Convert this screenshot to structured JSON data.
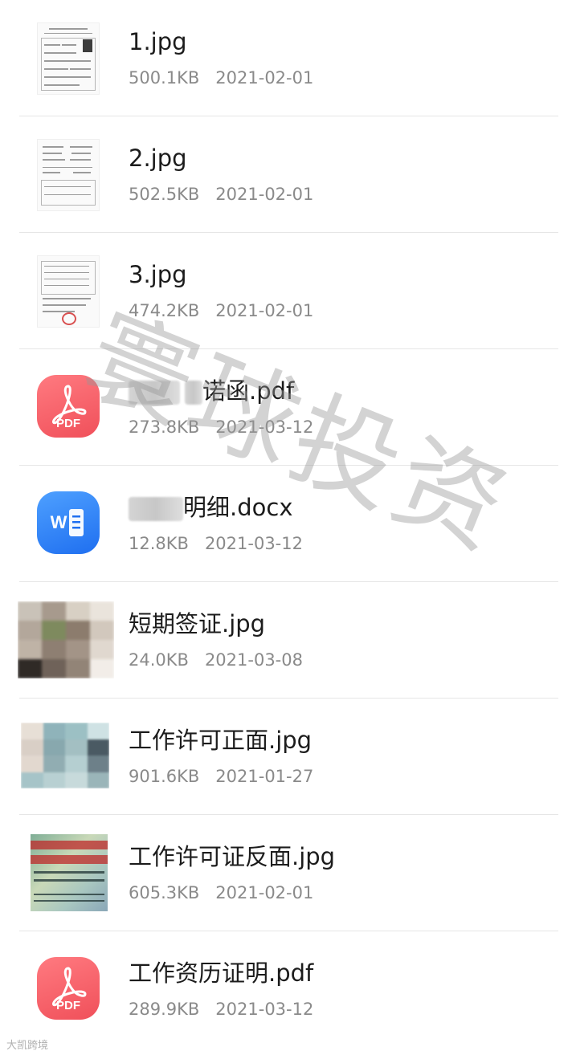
{
  "files": [
    {
      "name": "1.jpg",
      "size": "500.1KB",
      "date": "2021-02-01",
      "thumbnail": "document-scan-with-photo-icon"
    },
    {
      "name": "2.jpg",
      "size": "502.5KB",
      "date": "2021-02-01",
      "thumbnail": "document-scan-icon"
    },
    {
      "name": "3.jpg",
      "size": "474.2KB",
      "date": "2021-02-01",
      "thumbnail": "document-scan-with-stamp-icon"
    },
    {
      "name_visible": "诺函.pdf",
      "size": "273.8KB",
      "date": "2021-03-12",
      "thumbnail": "pdf-file-icon",
      "icon_label": "PDF"
    },
    {
      "name_visible": "明细.docx",
      "size": "12.8KB",
      "date": "2021-03-12",
      "thumbnail": "word-file-icon",
      "icon_label": "W"
    },
    {
      "name": "短期签证.jpg",
      "size_visible": "24.0KB",
      "date": "2021-03-08",
      "thumbnail": "blurred-photo-icon"
    },
    {
      "name": "工作许可正面.jpg",
      "size": "901.6KB",
      "date": "2021-01-27",
      "thumbnail": "blurred-permit-front-icon"
    },
    {
      "name": "工作许可证反面.jpg",
      "size": "605.3KB",
      "date": "2021-02-01",
      "thumbnail": "permit-back-icon"
    },
    {
      "name": "工作资历证明.pdf",
      "size": "289.9KB",
      "date": "2021-03-12",
      "thumbnail": "pdf-file-icon",
      "icon_label": "PDF"
    }
  ],
  "watermark": "寰球投资",
  "corner_logo": "大凯跨境",
  "colors": {
    "pdf_icon": "#f0505a",
    "word_icon": "#1f6ff0",
    "divider": "#e6e6e6",
    "meta_text": "#8a8a8a"
  }
}
